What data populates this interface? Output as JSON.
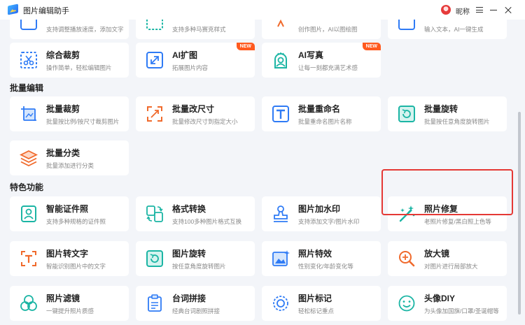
{
  "app": {
    "title": "图片编辑助手",
    "user_name": "昵称"
  },
  "row0": [
    {
      "desc": "支持调整播放速度，添加文字"
    },
    {
      "desc": "支持多种马赛克样式"
    },
    {
      "desc": "创作图片，AI以图绘图"
    },
    {
      "desc": "输入文本，AI一键生成"
    }
  ],
  "row1": [
    {
      "title": "综合裁剪",
      "desc": "操作简单，轻松编辑图片",
      "icon": "scissors-icon"
    },
    {
      "title": "AI扩图",
      "desc": "拓展图片内容",
      "badge": "NEW",
      "icon": "expand-icon"
    },
    {
      "title": "AI写真",
      "desc": "让每一刻都充满艺术感",
      "badge": "NEW",
      "icon": "portrait-icon"
    }
  ],
  "batch": {
    "heading": "批量编辑",
    "items": [
      {
        "title": "批量裁剪",
        "desc": "批量按比例/按尺寸裁剪图片",
        "icon": "crop-icon"
      },
      {
        "title": "批量改尺寸",
        "desc": "批量修改尺寸到指定大小",
        "icon": "resize-icon"
      },
      {
        "title": "批量重命名",
        "desc": "批量重命名图片名称",
        "icon": "text-t-icon"
      },
      {
        "title": "批量旋转",
        "desc": "批量按任意角度旋转图片",
        "icon": "rotate-icon"
      },
      {
        "title": "批量分类",
        "desc": "批量添加进行分类",
        "icon": "layers-icon"
      }
    ]
  },
  "features": {
    "heading": "特色功能",
    "items": [
      {
        "title": "智能证件照",
        "desc": "支持多种规格的证件照",
        "icon": "id-photo-icon"
      },
      {
        "title": "格式转换",
        "desc": "支持100多种图片格式互换",
        "icon": "convert-icon"
      },
      {
        "title": "图片加水印",
        "desc": "支持添加文字/图片水印",
        "icon": "stamp-icon"
      },
      {
        "title": "照片修复",
        "desc": "老照片修复/黑白照上色等",
        "icon": "magic-wand-icon"
      },
      {
        "title": "图片转文字",
        "desc": "智能识别图片中的文字",
        "icon": "ocr-icon"
      },
      {
        "title": "图片旋转",
        "desc": "按任意角度旋转图片",
        "icon": "rotate-icon"
      },
      {
        "title": "照片特效",
        "desc": "性别变化/年龄变化等",
        "icon": "image-effect-icon"
      },
      {
        "title": "放大镜",
        "desc": "对图片进行局部放大",
        "icon": "magnifier-icon"
      },
      {
        "title": "照片滤镜",
        "desc": "一键提升照片质感",
        "icon": "filter-icon"
      },
      {
        "title": "台词拼接",
        "desc": "经典台词剧照拼接",
        "icon": "clipboard-icon"
      },
      {
        "title": "图片标记",
        "desc": "轻松标记重点",
        "icon": "marker-icon"
      },
      {
        "title": "头像DIY",
        "desc": "为头像加国旗/口罩/圣诞帽等",
        "icon": "smile-icon"
      }
    ]
  },
  "colors": {
    "accent": "#2f7bf5",
    "teal": "#1bb5a4",
    "orange": "#f06a2c",
    "highlight": "#e53935"
  }
}
